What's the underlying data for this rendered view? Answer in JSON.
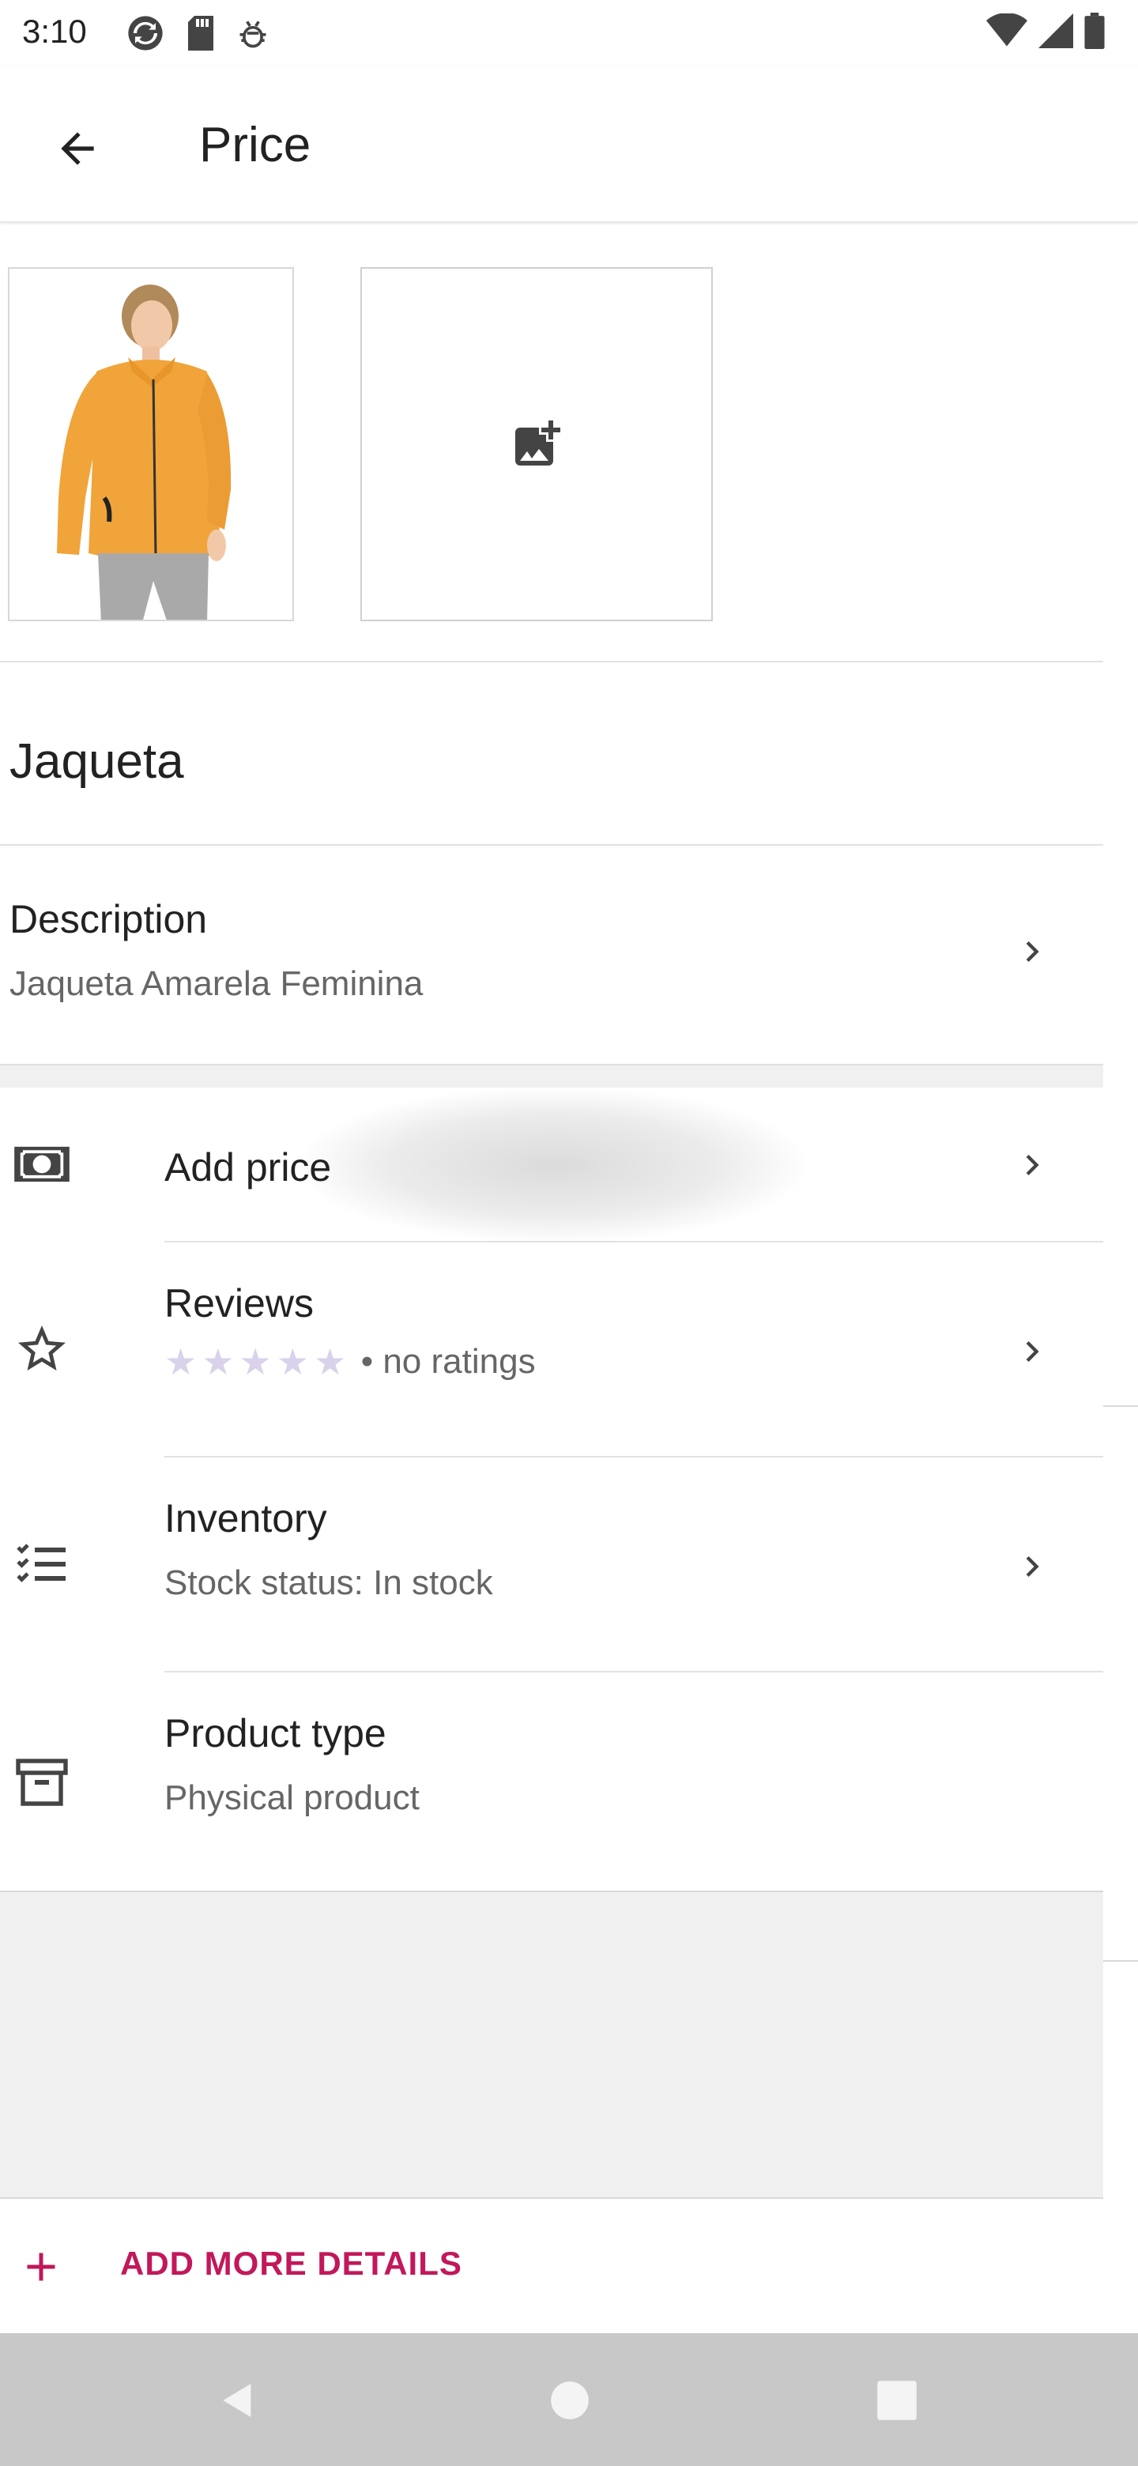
{
  "status_bar": {
    "time": "3:10",
    "icons_left": [
      "sync-icon",
      "sd-card-icon",
      "debug-icon"
    ],
    "icons_right": [
      "wifi-icon",
      "signal-icon",
      "battery-icon"
    ]
  },
  "app_bar": {
    "title": "Price",
    "back_icon": "arrow-back-icon"
  },
  "images": {
    "product_image_alt": "Orange jacket product photo",
    "add_image_icon": "add-photo-icon"
  },
  "product": {
    "name": "Jaqueta"
  },
  "description": {
    "title": "Description",
    "value": "Jaqueta Amarela Feminina"
  },
  "details": {
    "price": {
      "title": "Add price",
      "icon": "money-icon"
    },
    "reviews": {
      "title": "Reviews",
      "rating_text": "• no ratings",
      "stars_filled": 0,
      "stars_total": 5,
      "icon": "star-outline-icon"
    },
    "inventory": {
      "title": "Inventory",
      "value": "Stock status: In stock",
      "icon": "checklist-icon"
    },
    "product_type": {
      "title": "Product type",
      "value": "Physical product",
      "icon": "archive-icon"
    }
  },
  "add_more": {
    "label": "ADD MORE DETAILS",
    "icon": "plus-icon"
  },
  "colors": {
    "accent": "#c2185b",
    "star_empty": "#d9d2ea",
    "nav_bar": "#c8c8c8"
  },
  "nav_bar": {
    "buttons": [
      "back-triangle-icon",
      "home-circle-icon",
      "recents-square-icon"
    ]
  }
}
